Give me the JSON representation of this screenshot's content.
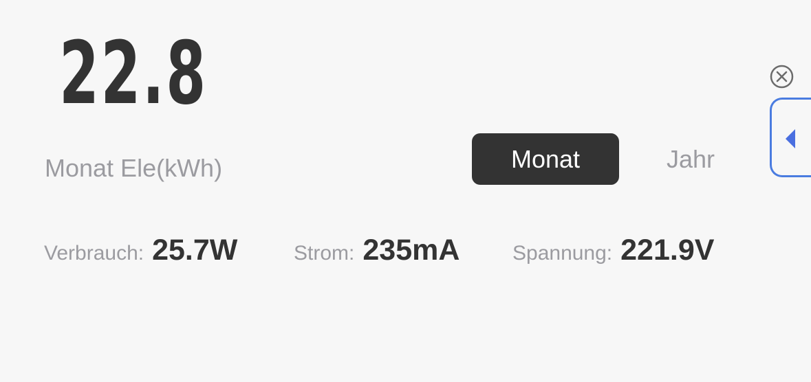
{
  "summary": {
    "value": "22.8",
    "unit_label": "Monat Ele(kWh)"
  },
  "period_toggle": {
    "options": [
      "Monat",
      "Jahr"
    ],
    "selected": "Monat"
  },
  "stats": {
    "consumption": {
      "label": "Verbrauch:",
      "value": "25.7W"
    },
    "current": {
      "label": "Strom:",
      "value": "235mA"
    },
    "voltage": {
      "label": "Spannung:",
      "value": "221.9V"
    }
  },
  "icons": {
    "close": "close-circle-icon",
    "side_tab": "chevron-left-icon"
  },
  "colors": {
    "background": "#f7f7f7",
    "text_dark": "#333333",
    "text_muted": "#9b9ba0",
    "accent": "#4a7ce0",
    "active_segment": "#333333"
  }
}
